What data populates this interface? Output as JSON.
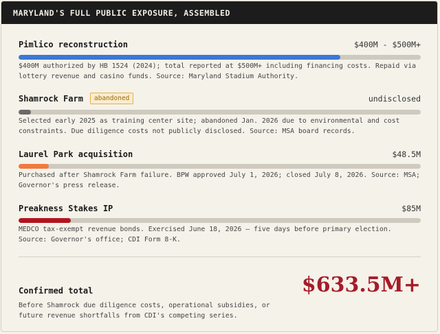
{
  "header": {
    "title": "MARYLAND'S FULL PUBLIC EXPOSURE, ASSEMBLED"
  },
  "items": [
    {
      "title": "Pimlico reconstruction",
      "value": "$400M - $500M+",
      "badge": "",
      "fraction": 0.8,
      "color": "#3b78d6",
      "desc": "$400M authorized by HB 1524 (2024); total reported at $500M+ including financing costs. Repaid via lottery revenue and casino funds. Source: Maryland Stadium Authority."
    },
    {
      "title": "Shamrock Farm",
      "value": "undisclosed",
      "badge": "abandoned",
      "fraction": 0.03,
      "color": "#6b6b6b",
      "desc": "Selected early 2025 as training center site; abandoned Jan. 2026 due to environmental and cost constraints. Due diligence costs not publicly disclosed. Source: MSA board records."
    },
    {
      "title": "Laurel Park acquisition",
      "value": "$48.5M",
      "badge": "",
      "fraction": 0.075,
      "color": "#f07a3c",
      "desc": "Purchased after Shamrock Farm failure. BPW approved July 1, 2026; closed July 8, 2026. Source: MSA; Governor's press release."
    },
    {
      "title": "Preakness Stakes IP",
      "value": "$85M",
      "badge": "",
      "fraction": 0.13,
      "color": "#b3141f",
      "desc": "MEDCO tax-exempt revenue bonds. Exercised June 18, 2026 — five days before primary election. Source: Governor's office; CDI Form 8-K."
    }
  ],
  "total": {
    "label": "Confirmed total",
    "value": "$633.5M+",
    "desc": "Before Shamrock due diligence costs, operational subsidies, or future revenue shortfalls from CDI's competing series."
  }
}
